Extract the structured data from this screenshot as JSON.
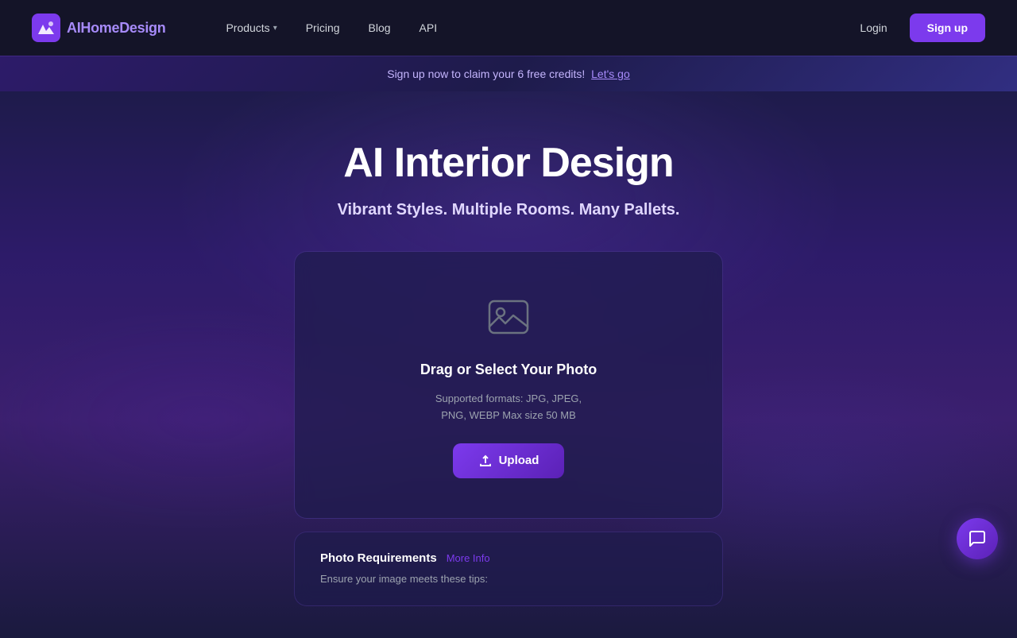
{
  "navbar": {
    "logo_ai": "AI",
    "logo_brand": "HomeDesign",
    "products_label": "Products",
    "pricing_label": "Pricing",
    "blog_label": "Blog",
    "api_label": "API",
    "login_label": "Login",
    "signup_label": "Sign up"
  },
  "banner": {
    "text": "Sign up now to claim your 6 free credits!",
    "link_text": "Let's go"
  },
  "hero": {
    "title": "AI Interior Design",
    "subtitle": "Vibrant Styles. Multiple Rooms. Many Pallets."
  },
  "upload_card": {
    "drag_text": "Drag or Select Your Photo",
    "formats_text": "Supported formats: JPG, JPEG,",
    "formats_text2": "PNG, WEBP Max size 50 MB",
    "upload_button_label": "Upload"
  },
  "requirements_card": {
    "title": "Photo Requirements",
    "more_info_label": "More Info",
    "description": "Ensure your image meets these tips:"
  }
}
